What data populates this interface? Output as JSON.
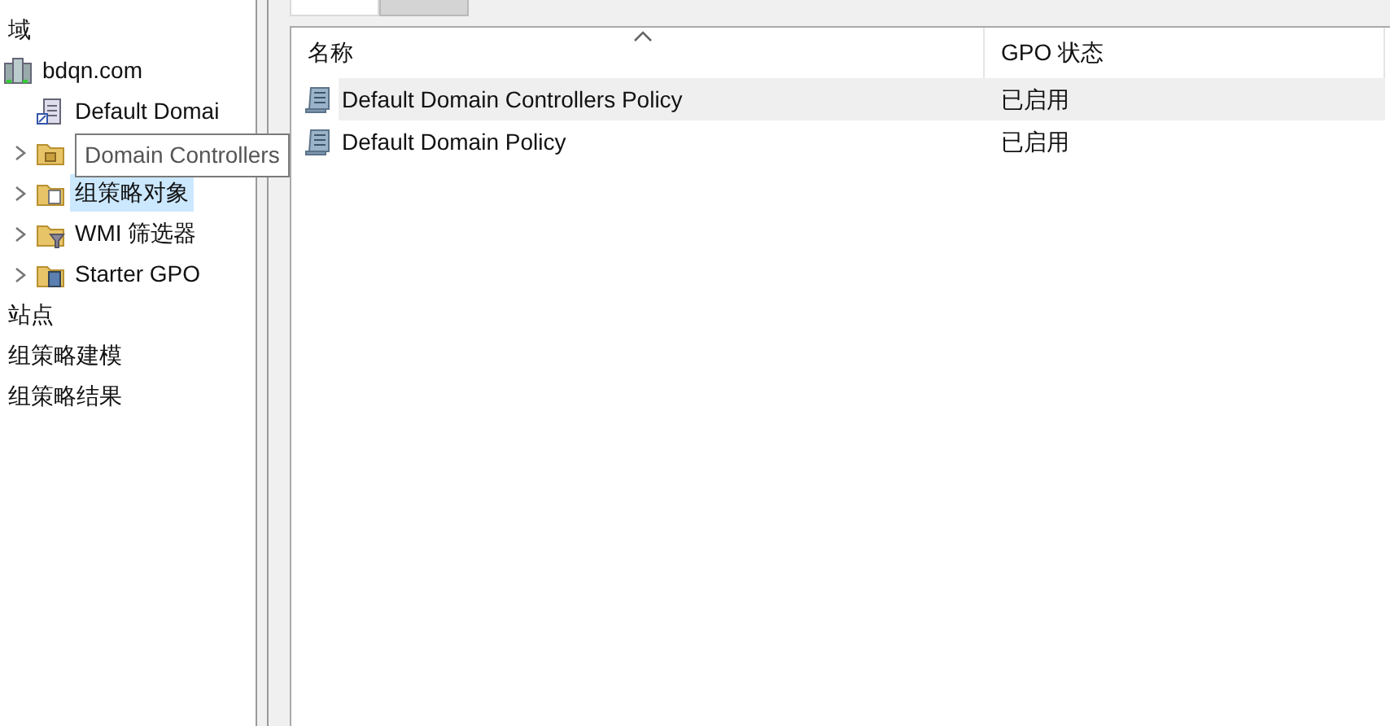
{
  "tree": [
    {
      "label": "域",
      "kind": "plain",
      "selected": false
    },
    {
      "label": "bdqn.com",
      "kind": "domain",
      "selected": false,
      "children": [
        {
          "label": "Default Domai",
          "kind": "gpo-link",
          "expandable": false,
          "selected": false
        },
        {
          "kind": "ou",
          "expandable": true,
          "selected": false
        },
        {
          "label": "组策略对象",
          "kind": "gpo-folder",
          "expandable": true,
          "selected": true
        },
        {
          "label": "WMI 筛选器",
          "kind": "wmi",
          "expandable": true,
          "selected": false
        },
        {
          "label": "Starter GPO",
          "kind": "starter",
          "expandable": true,
          "selected": false
        }
      ]
    },
    {
      "label": "站点",
      "kind": "plain",
      "selected": false
    },
    {
      "label": "组策略建模",
      "kind": "plain",
      "selected": false
    },
    {
      "label": "组策略结果",
      "kind": "plain",
      "selected": false
    }
  ],
  "tooltip": {
    "text": "Domain Controllers"
  },
  "tabs": [
    {
      "selected": true
    },
    {
      "selected": false
    }
  ],
  "table": {
    "columns": [
      "名称",
      "GPO 状态"
    ],
    "rows": [
      {
        "name": "Default Domain Controllers Policy",
        "status": "已启用",
        "selected": true
      },
      {
        "name": "Default Domain Policy",
        "status": "已启用",
        "selected": false
      }
    ]
  }
}
